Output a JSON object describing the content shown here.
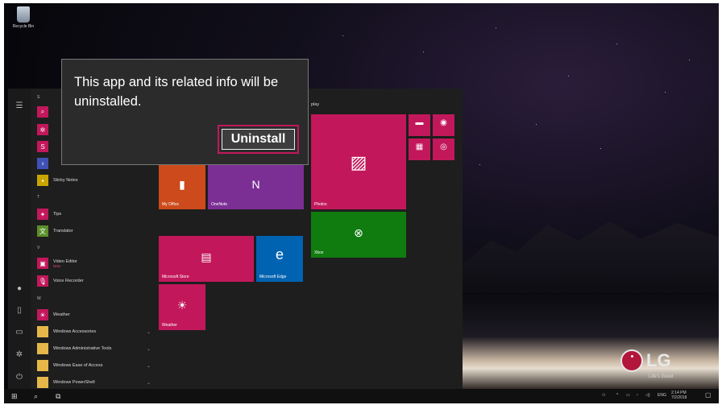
{
  "desktop": {
    "recycle_bin_label": "Recycle Bin",
    "brand_logo": "LG",
    "brand_tagline": "Life's Good"
  },
  "start_menu": {
    "letters": [
      "S",
      "T",
      "V",
      "W"
    ],
    "apps": [
      {
        "label": "",
        "icon": "search-icon",
        "color": "#c2185b"
      },
      {
        "label": "",
        "icon": "gear-icon",
        "color": "#c2185b"
      },
      {
        "label": "",
        "icon": "skype-icon",
        "color": "#c2185b"
      },
      {
        "label": "",
        "icon": "tips-icon",
        "color": "#3f51b5"
      },
      {
        "label": "Sticky Notes",
        "icon": "sticky-notes-icon",
        "color": "#c9a400"
      },
      {
        "label": "Tips",
        "icon": "tips-icon",
        "color": "#c2185b"
      },
      {
        "label": "Translator",
        "icon": "translator-icon",
        "color": "#5b8f2a"
      },
      {
        "label": "Video Editor",
        "sub": "New",
        "icon": "video-editor-icon",
        "color": "#c2185b"
      },
      {
        "label": "Voice Recorder",
        "icon": "microphone-icon",
        "color": "#c2185b"
      },
      {
        "label": "Weather",
        "icon": "weather-icon",
        "color": "#c2185b"
      },
      {
        "label": "Windows Accessories",
        "icon": "folder-icon",
        "color": "#e6b84a"
      },
      {
        "label": "Windows Administrative Tools",
        "icon": "folder-icon",
        "color": "#e6b84a"
      },
      {
        "label": "Windows Ease of Access",
        "icon": "folder-icon",
        "color": "#e6b84a"
      },
      {
        "label": "Windows PowerShell",
        "icon": "folder-icon",
        "color": "#e6b84a"
      }
    ],
    "group_label": "play",
    "tiles": {
      "my_office": "My Office",
      "onenote": "OneNote",
      "photos": "Photos",
      "xbox": "Xbox",
      "microsoft_store": "Microsoft Store",
      "microsoft_edge": "Microsoft Edge",
      "weather": "Weather"
    }
  },
  "dialog": {
    "message": "This app and its related info will be uninstalled.",
    "uninstall_label": "Uninstall"
  },
  "taskbar": {
    "tray_language": "ENG",
    "clock_time": "2:14 PM",
    "clock_date": "7/2/2018"
  },
  "colors": {
    "accent": "#c2185b",
    "tile_orange": "#cc4a1b",
    "tile_purple": "#7b2f94",
    "tile_green": "#107c10",
    "tile_blue": "#0063b1"
  }
}
